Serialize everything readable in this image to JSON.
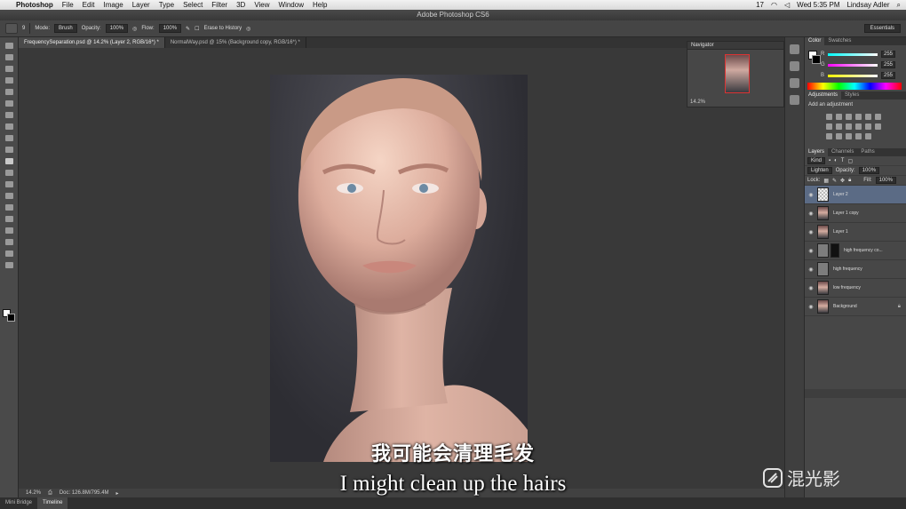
{
  "menubar": {
    "app": "Photoshop",
    "items": [
      "File",
      "Edit",
      "Image",
      "Layer",
      "Type",
      "Select",
      "Filter",
      "3D",
      "View",
      "Window",
      "Help"
    ],
    "badge": "17",
    "clock": "Wed 5:35 PM",
    "user": "Lindsay Adler"
  },
  "window_title": "Adobe Photoshop CS6",
  "options": {
    "brush_size": "9",
    "mode_label": "Mode:",
    "mode_value": "Brush",
    "opacity_label": "Opacity:",
    "opacity_value": "100%",
    "flow_label": "Flow:",
    "flow_value": "100%",
    "erase_history": "Erase to History",
    "workspace": "Essentials"
  },
  "doc_tabs": [
    {
      "label": "FrequencySeparation.psd @ 14.2% (Layer 2, RGB/16*) *"
    },
    {
      "label": "NormalWay.psd @ 15% (Background copy, RGB/16*) *"
    }
  ],
  "statusbar": {
    "zoom": "14.2%",
    "doc": "Doc: 126.8M/795.4M"
  },
  "timeline_tabs": [
    "Mini Bridge",
    "Timeline"
  ],
  "navigator": {
    "title": "Navigator",
    "zoom": "14.2%"
  },
  "color_panel": {
    "tabs": [
      "Color",
      "Swatches"
    ],
    "channels": [
      {
        "label": "R",
        "value": "255"
      },
      {
        "label": "G",
        "value": "255"
      },
      {
        "label": "B",
        "value": "255"
      }
    ]
  },
  "adjustments": {
    "tabs": [
      "Adjustments",
      "Styles"
    ],
    "title": "Add an adjustment"
  },
  "layers_panel": {
    "tabs": [
      "Layers",
      "Channels",
      "Paths"
    ],
    "kind": "Kind",
    "blend_mode": "Lighten",
    "opacity_label": "Opacity:",
    "opacity_value": "100%",
    "lock_label": "Lock:",
    "fill_label": "Fill:",
    "fill_value": "100%",
    "layers": [
      {
        "name": "Layer 2",
        "thumb": "trans",
        "selected": true
      },
      {
        "name": "Layer 1 copy",
        "thumb": "portrait",
        "selected": false
      },
      {
        "name": "Layer 1",
        "thumb": "portrait",
        "selected": false
      },
      {
        "name": "high frequency co...",
        "thumb": "gray",
        "selected": false
      },
      {
        "name": "high frequency",
        "thumb": "gray",
        "selected": false
      },
      {
        "name": "low frequency",
        "thumb": "portrait",
        "selected": false
      },
      {
        "name": "Background",
        "thumb": "portrait",
        "selected": false
      }
    ]
  },
  "subtitles": {
    "cn": "我可能会清理毛发",
    "en": "I might clean up the hairs"
  },
  "watermark": "混光影"
}
